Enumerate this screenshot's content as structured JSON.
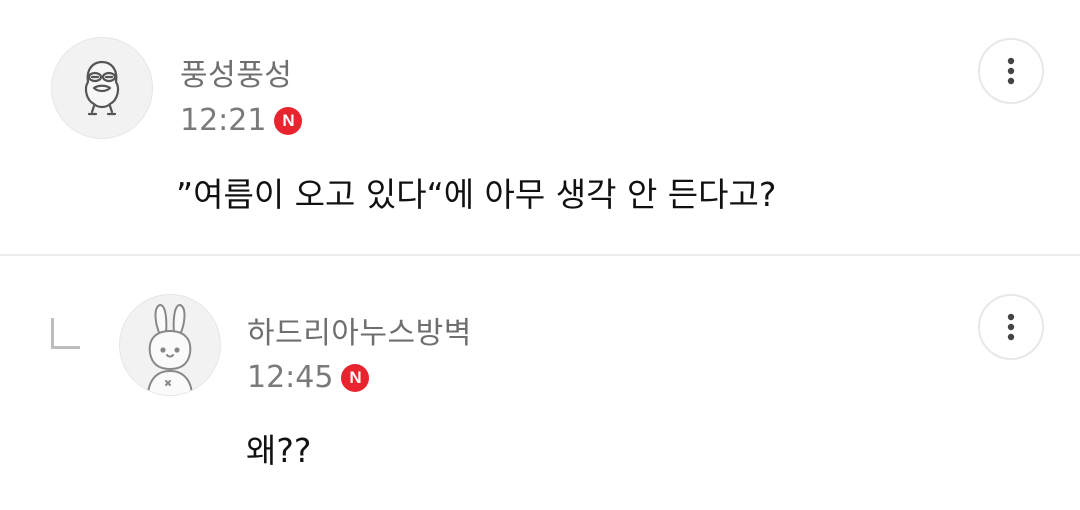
{
  "colors": {
    "badge": "#e8242e",
    "author_text": "#6f6f6f",
    "body_text": "#111111",
    "divider": "#ececec"
  },
  "comments": [
    {
      "author": "풍성풍성",
      "time": "12:21",
      "badge": "N",
      "text": "”여름이 오고 있다“에 아무 생각 안 든다고?",
      "avatar_icon": "frog-avatar-icon",
      "more_icon": "more-vertical-icon"
    },
    {
      "author": "하드리아누스방벽",
      "time": "12:45",
      "badge": "N",
      "text": "왜??",
      "avatar_icon": "rabbit-avatar-icon",
      "more_icon": "more-vertical-icon",
      "reply_icon": "reply-indent-icon"
    }
  ]
}
